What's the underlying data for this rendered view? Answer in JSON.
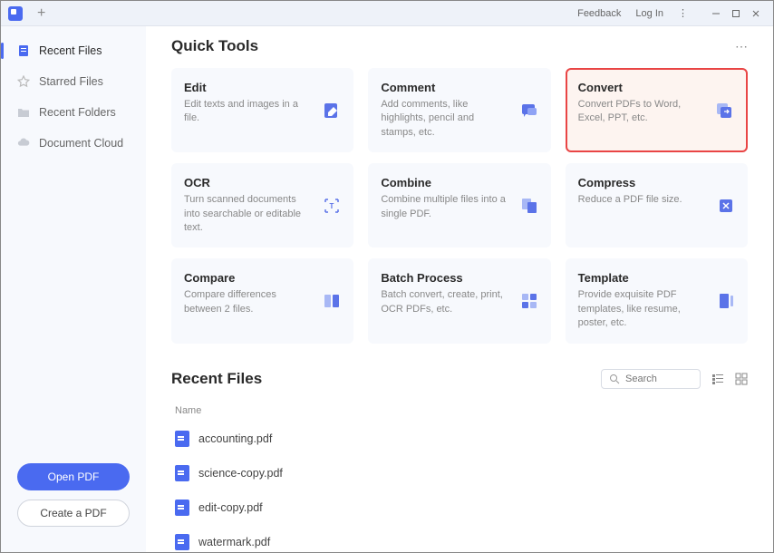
{
  "titlebar": {
    "feedback": "Feedback",
    "login": "Log In"
  },
  "sidebar": {
    "items": [
      {
        "label": "Recent Files"
      },
      {
        "label": "Starred Files"
      },
      {
        "label": "Recent Folders"
      },
      {
        "label": "Document Cloud"
      }
    ],
    "open_pdf": "Open PDF",
    "create_pdf": "Create a PDF"
  },
  "quick_tools": {
    "title": "Quick Tools",
    "cards": [
      {
        "title": "Edit",
        "desc": "Edit texts and images in a file."
      },
      {
        "title": "Comment",
        "desc": "Add comments, like highlights, pencil and stamps, etc."
      },
      {
        "title": "Convert",
        "desc": "Convert PDFs to Word, Excel, PPT, etc."
      },
      {
        "title": "OCR",
        "desc": "Turn scanned documents into searchable or editable text."
      },
      {
        "title": "Combine",
        "desc": "Combine multiple files into a single PDF."
      },
      {
        "title": "Compress",
        "desc": "Reduce a PDF file size."
      },
      {
        "title": "Compare",
        "desc": "Compare differences between 2 files."
      },
      {
        "title": "Batch Process",
        "desc": "Batch convert, create, print, OCR PDFs, etc."
      },
      {
        "title": "Template",
        "desc": "Provide exquisite PDF templates, like resume, poster, etc."
      }
    ]
  },
  "recent": {
    "title": "Recent Files",
    "search_placeholder": "Search",
    "name_header": "Name",
    "files": [
      {
        "name": "accounting.pdf"
      },
      {
        "name": "science-copy.pdf"
      },
      {
        "name": "edit-copy.pdf"
      },
      {
        "name": "watermark.pdf"
      }
    ]
  }
}
